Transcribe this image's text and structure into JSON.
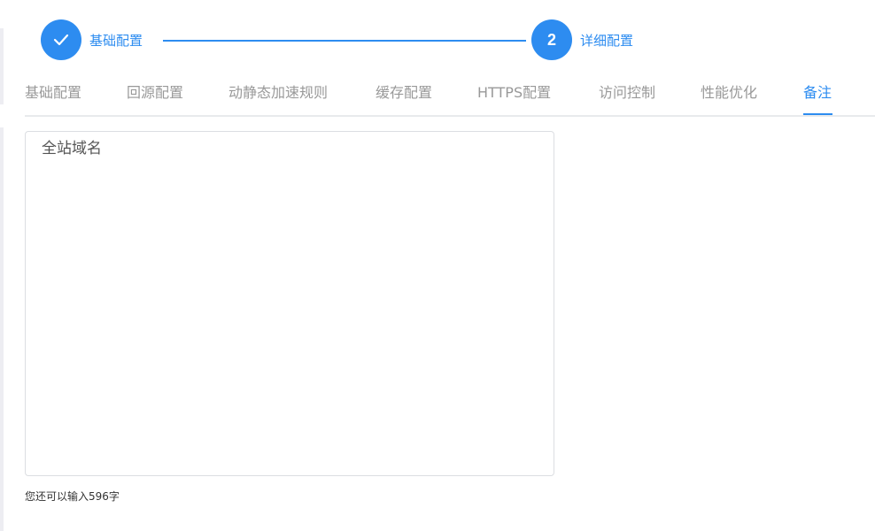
{
  "colors": {
    "accent": "#2d8cf0",
    "tab_inactive": "#999999",
    "border": "#dcdee2"
  },
  "steps": [
    {
      "label": "基础配置",
      "status": "done",
      "icon": "check-icon"
    },
    {
      "label": "详细配置",
      "status": "current",
      "number": "2"
    }
  ],
  "tabs": [
    {
      "label": "基础配置",
      "active": false
    },
    {
      "label": "回源配置",
      "active": false
    },
    {
      "label": "动静态加速规则",
      "active": false
    },
    {
      "label": "缓存配置",
      "active": false
    },
    {
      "label": "HTTPS配置",
      "active": false
    },
    {
      "label": "访问控制",
      "active": false
    },
    {
      "label": "性能优化",
      "active": false
    },
    {
      "label": "备注",
      "active": true
    }
  ],
  "note": {
    "value": "全站域名",
    "counter": "您还可以输入596字"
  }
}
